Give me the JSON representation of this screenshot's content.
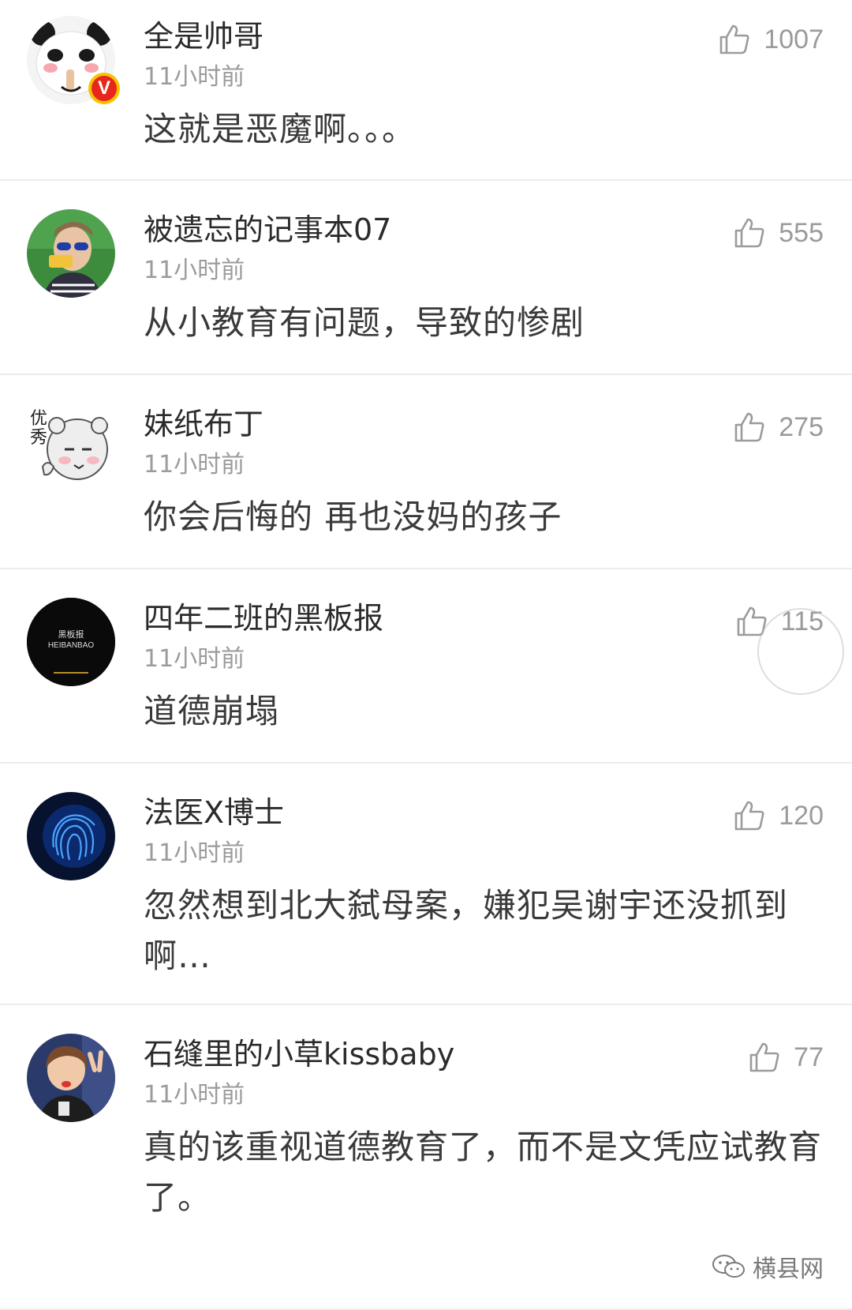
{
  "comments": [
    {
      "username": "全是帅哥",
      "time": "11小时前",
      "text": "这就是恶魔啊。。。",
      "likes": "1007",
      "verified": true,
      "avatar": "panda-meme-avatar"
    },
    {
      "username": "被遗忘的记事本07",
      "time": "11小时前",
      "text": "从小教育有问题，导致的惨剧",
      "likes": "555",
      "verified": false,
      "avatar": "man-sunglasses-avatar"
    },
    {
      "username": "妹纸布丁",
      "time": "11小时前",
      "text": "你会后悔的 再也没妈的孩子",
      "likes": "275",
      "verified": false,
      "avatar": "cartoon-bear-avatar",
      "avatar_text": "优秀"
    },
    {
      "username": "四年二班的黑板报",
      "time": "11小时前",
      "text": "道德崩塌",
      "likes": "115",
      "verified": false,
      "avatar": "black-logo-avatar",
      "avatar_text": "黑板报",
      "avatar_subtext": "HEIBANBAO"
    },
    {
      "username": "法医X博士",
      "time": "11小时前",
      "text": "忽然想到北大弑母案，嫌犯吴谢宇还没抓到啊…",
      "likes": "120",
      "verified": false,
      "avatar": "fingerprint-avatar"
    },
    {
      "username": "石缝里的小草kissbaby",
      "time": "11小时前",
      "text": "真的该重视道德教育了，而不是文凭应试教育了。",
      "likes": "77",
      "verified": false,
      "avatar": "child-photo-avatar"
    }
  ],
  "watermark": {
    "label": "横县网"
  },
  "colors": {
    "text_primary": "#2b2b2b",
    "text_secondary": "#9b9b9b",
    "divider": "#ececec",
    "verified_badge": "#e8271c"
  }
}
